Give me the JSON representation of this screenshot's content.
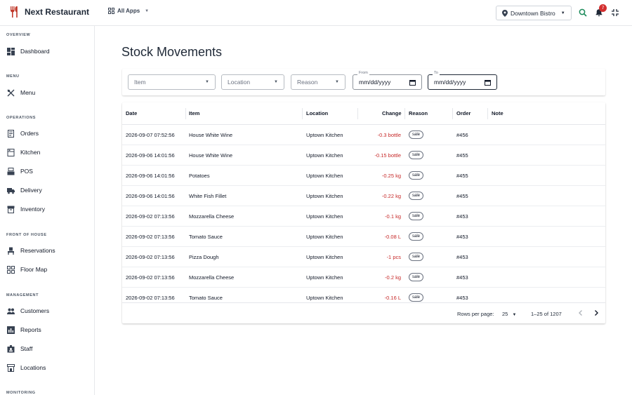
{
  "brand": {
    "name": "Next Restaurant"
  },
  "apps": {
    "label": "All Apps"
  },
  "branch": {
    "label": "Downtown Bistro"
  },
  "notifications": {
    "count": "7"
  },
  "colors": {
    "brand": "#c0392b",
    "accent_green": "#1b8a5a",
    "negative": "#c62828",
    "badge": "#d32f2f"
  },
  "sidebar": {
    "sections": [
      {
        "title": "OVERVIEW",
        "items": [
          {
            "label": "Dashboard",
            "icon": "dashboard-icon"
          }
        ]
      },
      {
        "title": "MENU",
        "items": [
          {
            "label": "Menu",
            "icon": "utensils-icon"
          }
        ]
      },
      {
        "title": "OPERATIONS",
        "items": [
          {
            "label": "Orders",
            "icon": "receipt-icon"
          },
          {
            "label": "Kitchen",
            "icon": "kitchen-icon"
          },
          {
            "label": "POS",
            "icon": "register-icon"
          },
          {
            "label": "Delivery",
            "icon": "truck-icon"
          },
          {
            "label": "Inventory",
            "icon": "archive-icon"
          }
        ]
      },
      {
        "title": "FRONT OF HOUSE",
        "items": [
          {
            "label": "Reservations",
            "icon": "chair-icon"
          },
          {
            "label": "Floor Map",
            "icon": "grid-icon"
          }
        ]
      },
      {
        "title": "MANAGEMENT",
        "items": [
          {
            "label": "Customers",
            "icon": "people-icon"
          },
          {
            "label": "Reports",
            "icon": "bar-chart-icon"
          },
          {
            "label": "Staff",
            "icon": "badge-icon"
          },
          {
            "label": "Locations",
            "icon": "store-icon"
          }
        ]
      },
      {
        "title": "MONITORING",
        "items": []
      }
    ]
  },
  "page": {
    "title": "Stock Movements"
  },
  "filters": {
    "item": {
      "label": "Item"
    },
    "location": {
      "label": "Location"
    },
    "reason": {
      "label": "Reason"
    },
    "from": {
      "label": "From",
      "value": "mm/dd/yyyy"
    },
    "to": {
      "label": "To",
      "value": "mm/dd/yyyy"
    }
  },
  "table": {
    "columns": [
      "Date",
      "Item",
      "Location",
      "Change",
      "Reason",
      "Order",
      "Note"
    ],
    "rows": [
      {
        "date": "2026-09-07 07:52:56",
        "item": "House White Wine",
        "location": "Uptown Kitchen",
        "change": "-0.3 bottle",
        "reason": "sale",
        "order": "#456",
        "note": ""
      },
      {
        "date": "2026-09-06 14:01:56",
        "item": "House White Wine",
        "location": "Uptown Kitchen",
        "change": "-0.15 bottle",
        "reason": "sale",
        "order": "#455",
        "note": ""
      },
      {
        "date": "2026-09-06 14:01:56",
        "item": "Potatoes",
        "location": "Uptown Kitchen",
        "change": "-0.25 kg",
        "reason": "sale",
        "order": "#455",
        "note": ""
      },
      {
        "date": "2026-09-06 14:01:56",
        "item": "White Fish Fillet",
        "location": "Uptown Kitchen",
        "change": "-0.22 kg",
        "reason": "sale",
        "order": "#455",
        "note": ""
      },
      {
        "date": "2026-09-02 07:13:56",
        "item": "Mozzarella Cheese",
        "location": "Uptown Kitchen",
        "change": "-0.1 kg",
        "reason": "sale",
        "order": "#453",
        "note": ""
      },
      {
        "date": "2026-09-02 07:13:56",
        "item": "Tomato Sauce",
        "location": "Uptown Kitchen",
        "change": "-0.08 L",
        "reason": "sale",
        "order": "#453",
        "note": ""
      },
      {
        "date": "2026-09-02 07:13:56",
        "item": "Pizza Dough",
        "location": "Uptown Kitchen",
        "change": "-1 pcs",
        "reason": "sale",
        "order": "#453",
        "note": ""
      },
      {
        "date": "2026-09-02 07:13:56",
        "item": "Mozzarella Cheese",
        "location": "Uptown Kitchen",
        "change": "-0.2 kg",
        "reason": "sale",
        "order": "#453",
        "note": ""
      },
      {
        "date": "2026-09-02 07:13:56",
        "item": "Tomato Sauce",
        "location": "Uptown Kitchen",
        "change": "-0.16 L",
        "reason": "sale",
        "order": "#453",
        "note": ""
      }
    ]
  },
  "pagination": {
    "rows_label": "Rows per page:",
    "rows_value": "25",
    "range": "1–25 of 1207"
  }
}
